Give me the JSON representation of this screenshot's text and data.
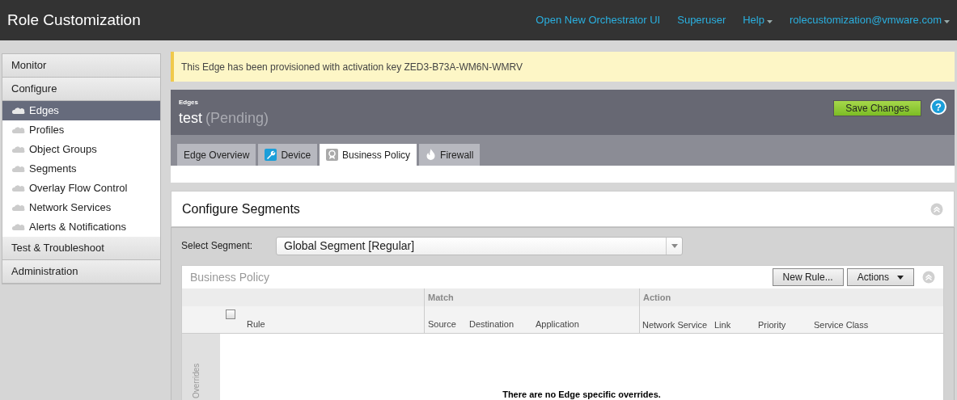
{
  "header": {
    "title": "Role Customization",
    "links": [
      {
        "label": "Open New Orchestrator UI",
        "dropdown": false
      },
      {
        "label": "Superuser",
        "dropdown": false
      },
      {
        "label": "Help",
        "dropdown": true
      },
      {
        "label": "rolecustomization@vmware.com",
        "dropdown": true
      }
    ]
  },
  "sidebar": {
    "items": [
      {
        "kind": "section",
        "label": "Monitor"
      },
      {
        "kind": "section",
        "label": "Configure"
      },
      {
        "kind": "item",
        "label": "Edges",
        "selected": true
      },
      {
        "kind": "item",
        "label": "Profiles",
        "selected": false
      },
      {
        "kind": "item",
        "label": "Object Groups",
        "selected": false
      },
      {
        "kind": "item",
        "label": "Segments",
        "selected": false
      },
      {
        "kind": "item",
        "label": "Overlay Flow Control",
        "selected": false
      },
      {
        "kind": "item",
        "label": "Network Services",
        "selected": false
      },
      {
        "kind": "item",
        "label": "Alerts & Notifications",
        "selected": false
      },
      {
        "kind": "section",
        "label": "Test & Troubleshoot"
      },
      {
        "kind": "section",
        "label": "Administration"
      }
    ]
  },
  "notice": "This Edge has been provisioned with activation key ZED3-B73A-WM6N-WMRV",
  "edge": {
    "breadcrumb": "Edges",
    "name": "test",
    "status": "(Pending)",
    "save_button": "Save Changes",
    "help": "?"
  },
  "tabs": [
    {
      "label": "Edge Overview",
      "selected": false
    },
    {
      "label": "Device",
      "selected": false
    },
    {
      "label": "Business Policy",
      "selected": true
    },
    {
      "label": "Firewall",
      "selected": false
    }
  ],
  "segments": {
    "title": "Configure Segments",
    "select_label": "Select Segment:",
    "select_value": "Global Segment [Regular]"
  },
  "policy": {
    "title": "Business Policy",
    "buttons": [
      "New Rule...",
      "Actions"
    ],
    "groups": [
      "Match",
      "Action"
    ],
    "select_all_checked": false,
    "columns": [
      "Rule",
      "Source",
      "Destination",
      "Application",
      "Network Service",
      "Link",
      "Priority",
      "Service Class"
    ],
    "side_label": "Overrides",
    "empty_message": "There are no Edge specific overrides."
  }
}
